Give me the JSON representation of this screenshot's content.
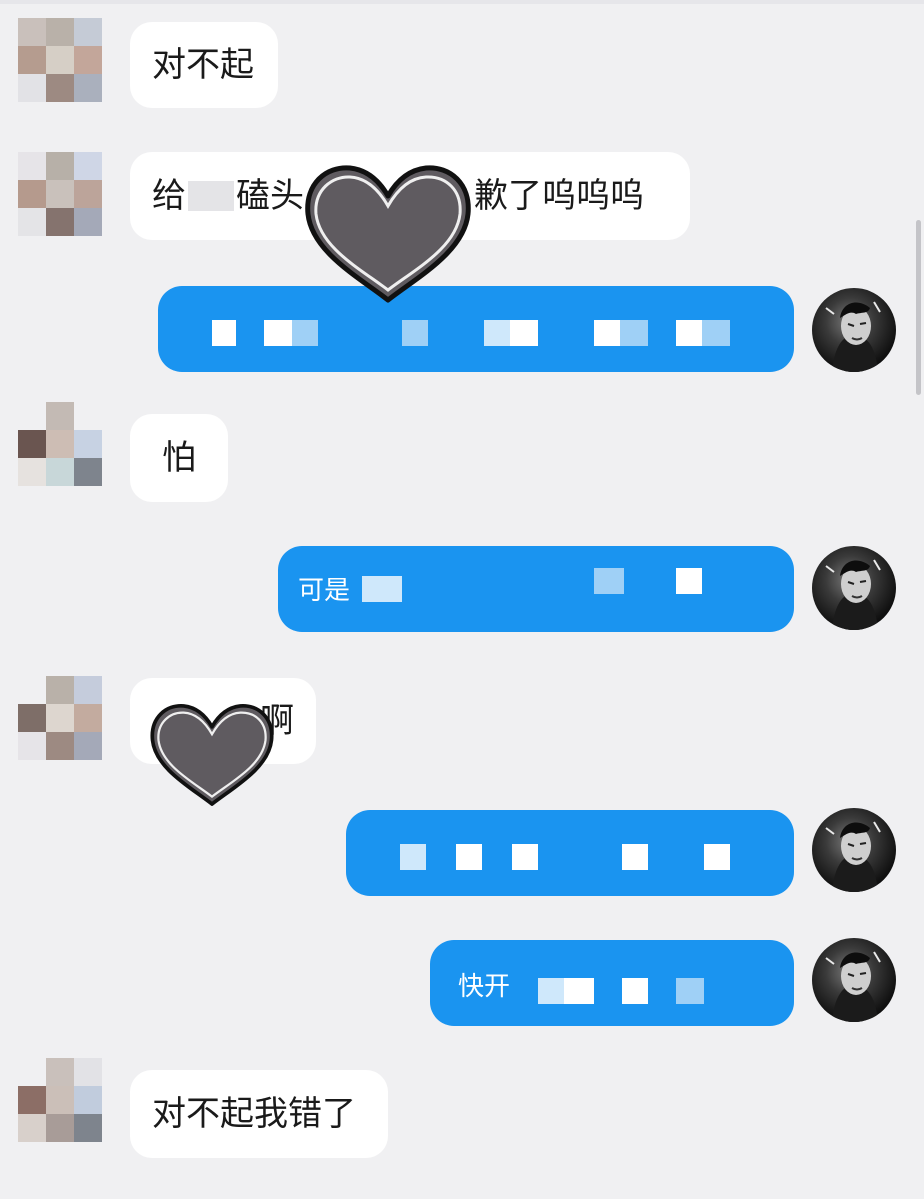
{
  "messages": {
    "m1": {
      "text": "对不起"
    },
    "m2": {
      "text_a": "给",
      "text_b": "磕头",
      "text_c": "歉了呜呜呜"
    },
    "m3": {
      "text": ""
    },
    "m4": {
      "text": "怕"
    },
    "m5": {
      "text": "可是"
    },
    "m6": {
      "text": "啊"
    },
    "m7": {
      "text": ""
    },
    "m8": {
      "text": "快开"
    },
    "m9": {
      "text": "对不起我错了"
    }
  },
  "colors": {
    "background": "#f0f0f2",
    "outgoing_bubble": "#1a94f0",
    "incoming_bubble": "#ffffff",
    "heart_sticker": "#5f5b60"
  },
  "icons": {
    "heart": "heart-sticker-icon",
    "avatar_self": "avatar-portrait-icon"
  }
}
